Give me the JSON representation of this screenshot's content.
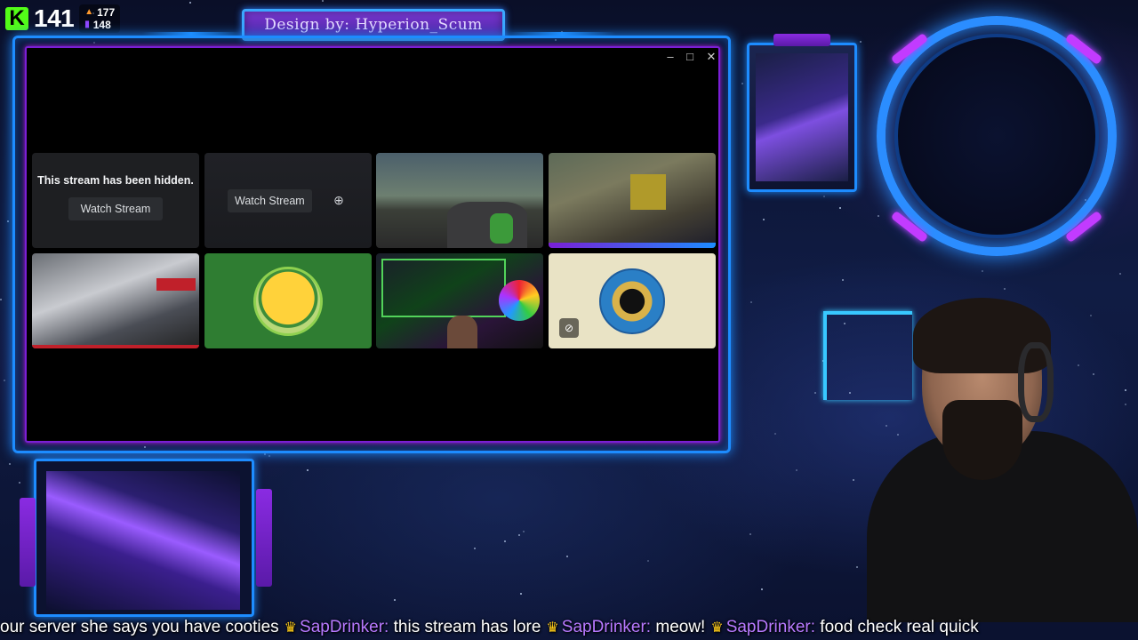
{
  "overlay": {
    "kick_count": "141",
    "stat_a": "177",
    "stat_b": "148",
    "banner_text": "Design by: Hyperion_Scum",
    "kick_logo": "K"
  },
  "window": {
    "controls": {
      "minimize": "–",
      "maximize": "□",
      "close": "✕"
    },
    "tiles": [
      {
        "type": "hidden",
        "message": "This stream has been hidden.",
        "button": "Watch Stream"
      },
      {
        "type": "preview-blurred",
        "button": "Watch Stream",
        "icon": "add-stream-icon"
      },
      {
        "type": "video",
        "content": "driving-stream"
      },
      {
        "type": "video",
        "content": "game-stream"
      },
      {
        "type": "video",
        "content": "office-stream"
      },
      {
        "type": "avatar",
        "content": "frog-avatar"
      },
      {
        "type": "video",
        "content": "streamer-cam"
      },
      {
        "type": "avatar",
        "content": "emblem-avatar",
        "icon": "muted-icon"
      }
    ]
  },
  "ticker": {
    "lead": "our server she says you have cooties",
    "messages": [
      {
        "user": "SapDrinker:",
        "text": "this stream has lore"
      },
      {
        "user": "SapDrinker:",
        "text": "meow!"
      },
      {
        "user": "SapDrinker:",
        "text": "food check real quick"
      }
    ]
  },
  "colors": {
    "frame_blue": "#1d8cff",
    "accent_purple": "#7a1fd6",
    "kick_green": "#53fc18",
    "ticker_user": "#b779ff"
  }
}
